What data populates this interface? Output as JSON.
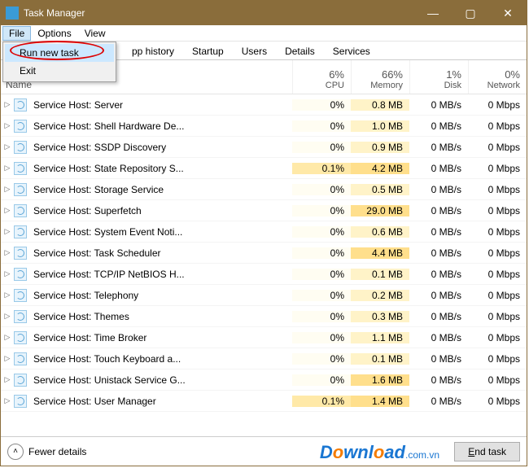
{
  "window": {
    "title": "Task Manager"
  },
  "menubar": {
    "file": "File",
    "options": "Options",
    "view": "View"
  },
  "file_menu": {
    "run_new_task": "Run new task",
    "exit": "Exit"
  },
  "tabs": {
    "app_history": "pp history",
    "startup": "Startup",
    "users": "Users",
    "details": "Details",
    "services": "Services"
  },
  "headers": {
    "name": "Name",
    "cpu_pct": "6%",
    "cpu_label": "CPU",
    "mem_pct": "66%",
    "mem_label": "Memory",
    "disk_pct": "1%",
    "disk_label": "Disk",
    "net_pct": "0%",
    "net_label": "Network"
  },
  "processes": [
    {
      "name": "Service Host: Server",
      "cpu": "0%",
      "mem": "0.8 MB",
      "disk": "0 MB/s",
      "net": "0 Mbps",
      "cpu_hot": false,
      "mem_hot": false
    },
    {
      "name": "Service Host: Shell Hardware De...",
      "cpu": "0%",
      "mem": "1.0 MB",
      "disk": "0 MB/s",
      "net": "0 Mbps",
      "cpu_hot": false,
      "mem_hot": false
    },
    {
      "name": "Service Host: SSDP Discovery",
      "cpu": "0%",
      "mem": "0.9 MB",
      "disk": "0 MB/s",
      "net": "0 Mbps",
      "cpu_hot": false,
      "mem_hot": false
    },
    {
      "name": "Service Host: State Repository S...",
      "cpu": "0.1%",
      "mem": "4.2 MB",
      "disk": "0 MB/s",
      "net": "0 Mbps",
      "cpu_hot": true,
      "mem_hot": true
    },
    {
      "name": "Service Host: Storage Service",
      "cpu": "0%",
      "mem": "0.5 MB",
      "disk": "0 MB/s",
      "net": "0 Mbps",
      "cpu_hot": false,
      "mem_hot": false
    },
    {
      "name": "Service Host: Superfetch",
      "cpu": "0%",
      "mem": "29.0 MB",
      "disk": "0 MB/s",
      "net": "0 Mbps",
      "cpu_hot": false,
      "mem_hot": true
    },
    {
      "name": "Service Host: System Event Noti...",
      "cpu": "0%",
      "mem": "0.6 MB",
      "disk": "0 MB/s",
      "net": "0 Mbps",
      "cpu_hot": false,
      "mem_hot": false
    },
    {
      "name": "Service Host: Task Scheduler",
      "cpu": "0%",
      "mem": "4.4 MB",
      "disk": "0 MB/s",
      "net": "0 Mbps",
      "cpu_hot": false,
      "mem_hot": true
    },
    {
      "name": "Service Host: TCP/IP NetBIOS H...",
      "cpu": "0%",
      "mem": "0.1 MB",
      "disk": "0 MB/s",
      "net": "0 Mbps",
      "cpu_hot": false,
      "mem_hot": false
    },
    {
      "name": "Service Host: Telephony",
      "cpu": "0%",
      "mem": "0.2 MB",
      "disk": "0 MB/s",
      "net": "0 Mbps",
      "cpu_hot": false,
      "mem_hot": false
    },
    {
      "name": "Service Host: Themes",
      "cpu": "0%",
      "mem": "0.3 MB",
      "disk": "0 MB/s",
      "net": "0 Mbps",
      "cpu_hot": false,
      "mem_hot": false
    },
    {
      "name": "Service Host: Time Broker",
      "cpu": "0%",
      "mem": "1.1 MB",
      "disk": "0 MB/s",
      "net": "0 Mbps",
      "cpu_hot": false,
      "mem_hot": false
    },
    {
      "name": "Service Host: Touch Keyboard a...",
      "cpu": "0%",
      "mem": "0.1 MB",
      "disk": "0 MB/s",
      "net": "0 Mbps",
      "cpu_hot": false,
      "mem_hot": false
    },
    {
      "name": "Service Host: Unistack Service G...",
      "cpu": "0%",
      "mem": "1.6 MB",
      "disk": "0 MB/s",
      "net": "0 Mbps",
      "cpu_hot": false,
      "mem_hot": true
    },
    {
      "name": "Service Host: User Manager",
      "cpu": "0.1%",
      "mem": "1.4 MB",
      "disk": "0 MB/s",
      "net": "0 Mbps",
      "cpu_hot": true,
      "mem_hot": true
    }
  ],
  "footer": {
    "fewer": "Fewer details",
    "endtask_prefix": "E",
    "endtask_rest": "nd task"
  },
  "watermark": {
    "text1": "Download",
    "ext": ".com.vn"
  }
}
